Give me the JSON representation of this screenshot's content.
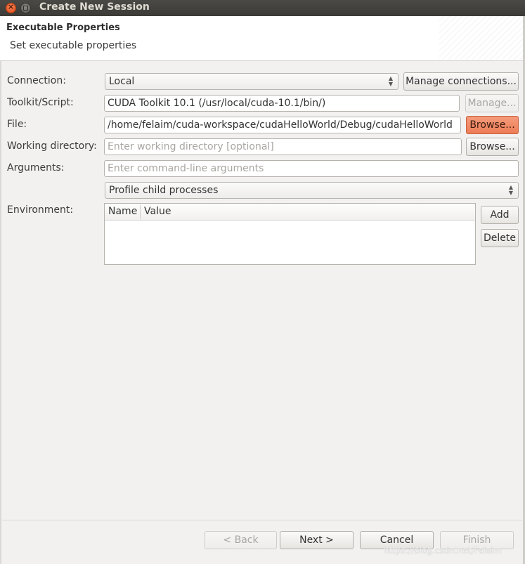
{
  "window": {
    "title": "Create New Session"
  },
  "header": {
    "title": "Executable Properties",
    "subtitle": "Set executable properties"
  },
  "form": {
    "connection": {
      "label": "Connection:",
      "value": "Local",
      "manage_label": "Manage connections..."
    },
    "toolkit": {
      "label": "Toolkit/Script:",
      "value": "CUDA Toolkit 10.1 (/usr/local/cuda-10.1/bin/)",
      "manage_label": "Manage..."
    },
    "file": {
      "label": "File:",
      "value": "/home/felaim/cuda-workspace/cudaHelloWorld/Debug/cudaHelloWorld",
      "browse_label": "Browse..."
    },
    "working_dir": {
      "label": "Working directory:",
      "placeholder": "Enter working directory [optional]",
      "browse_label": "Browse..."
    },
    "arguments": {
      "label": "Arguments:",
      "placeholder": "Enter command-line arguments"
    },
    "profile_mode": {
      "value": "Profile child processes"
    },
    "environment": {
      "label": "Environment:",
      "columns": [
        "Name",
        "Value"
      ],
      "add_label": "Add",
      "delete_label": "Delete"
    }
  },
  "footer": {
    "back": "< Back",
    "next": "Next >",
    "cancel": "Cancel",
    "finish": "Finish"
  },
  "watermark": "https://blog.csdn.net/Felaim",
  "colors": {
    "titlebar": "#3c3b37",
    "accent": "#ec7d57",
    "close": "#df4a16"
  }
}
